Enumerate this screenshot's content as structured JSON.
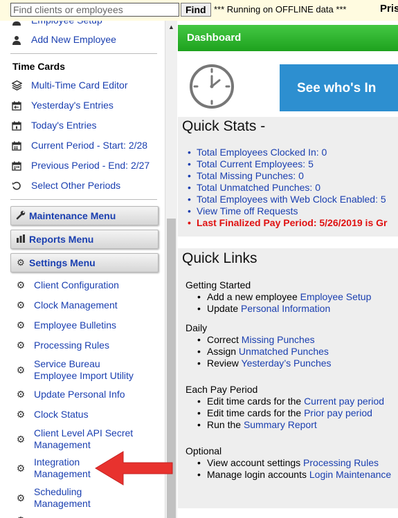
{
  "topbar": {
    "search_placeholder": "Find clients or employees",
    "find_label": "Find",
    "offline_text": "*** Running on OFFLINE data ***",
    "brand_text": "Pris"
  },
  "sidebar": {
    "top_items": [
      {
        "label": "Employee Setup",
        "icon": "person-icon"
      },
      {
        "label": "Add New Employee",
        "icon": "person-icon"
      }
    ],
    "time_cards_heading": "Time Cards",
    "time_card_items": [
      {
        "label": "Multi-Time Card Editor",
        "icon": "layers-icon"
      },
      {
        "label": "Yesterday's Entries",
        "icon": "calendar-icon"
      },
      {
        "label": "Today's Entries",
        "icon": "calendar-icon"
      },
      {
        "label": "Current Period - Start: 2/28",
        "icon": "calendar-icon"
      },
      {
        "label": "Previous Period - End: 2/27",
        "icon": "calendar-icon"
      },
      {
        "label": "Select Other Periods",
        "icon": "refresh-icon"
      }
    ],
    "menus": [
      {
        "label": "Maintenance Menu",
        "icon": "wrench-icon"
      },
      {
        "label": "Reports Menu",
        "icon": "bar-chart-icon"
      },
      {
        "label": "Settings Menu",
        "icon": "gear-icon"
      }
    ],
    "settings_items": [
      {
        "label": "Client Configuration"
      },
      {
        "label": "Clock Management"
      },
      {
        "label": "Employee Bulletins"
      },
      {
        "label": "Processing Rules"
      },
      {
        "label1": "Service Bureau",
        "label2": "Employee Import Utility"
      },
      {
        "label": "Update Personal Info"
      },
      {
        "label": "Clock Status"
      },
      {
        "label1": "Client Level API Secret",
        "label2": "Management"
      },
      {
        "label1": "Integration",
        "label2": "Management"
      },
      {
        "label1": "Scheduling",
        "label2": "Management"
      }
    ]
  },
  "main": {
    "dashboard_title": "Dashboard",
    "banner_text": "See who's In",
    "quick_stats": {
      "title": "Quick Stats -",
      "items": [
        "Total Employees Clocked In: 0",
        "Total Current Employees: 5",
        "Total Missing Punches: 0",
        "Total Unmatched Punches: 0",
        "Total Employees with Web Clock Enabled: 5",
        "View Time off Requests"
      ],
      "alert": "Last Finalized Pay Period: 5/26/2019 is Gr"
    },
    "quick_links": {
      "title": "Quick Links",
      "getting_started": {
        "heading": "Getting Started",
        "row1_pre": "Add a new employee ",
        "row1_link": "Employee Setup",
        "row2_pre": "Update ",
        "row2_link": "Personal Information"
      },
      "daily": {
        "heading": "Daily",
        "row1_pre": "Correct ",
        "row1_link": "Missing Punches",
        "row2_pre": "Assign ",
        "row2_link": "Unmatched Punches",
        "row3_pre": "Review ",
        "row3_link": "Yesterday’s Punches"
      },
      "each_pay_period": {
        "heading": "Each Pay Period",
        "row1_pre": "Edit time cards for the ",
        "row1_link": "Current pay period",
        "row2_pre": "Edit time cards for the ",
        "row2_link": "Prior pay period",
        "row3_pre": "Run the ",
        "row3_link": "Summary Report"
      },
      "optional": {
        "heading": "Optional",
        "row1_pre": "View account settings ",
        "row1_link": "Processing Rules",
        "row2_pre": "Manage login accounts ",
        "row2_link": "Login Maintenance"
      }
    }
  },
  "colors": {
    "link": "#1a3fb0",
    "dashboard_green": "#2cb52c",
    "alert_red": "#e01010",
    "arrow_red": "#e8322e",
    "banner_blue": "#2d8fd0"
  }
}
